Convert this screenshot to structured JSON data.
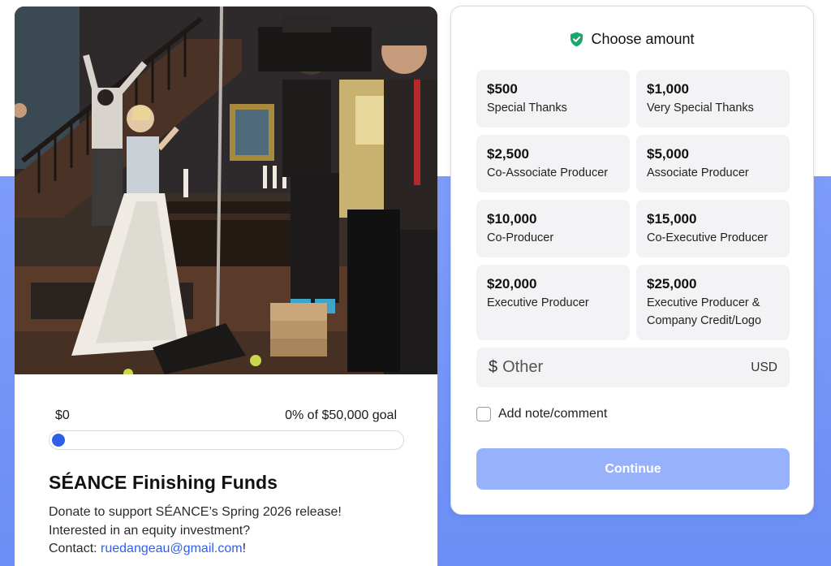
{
  "campaign": {
    "raised": "$0",
    "goal_text": "0% of $50,000 goal",
    "progress_percent": 0,
    "title": "SÉANCE Finishing Funds",
    "desc_line1": "Donate to support SÉANCE’s Spring 2026 release!",
    "desc_line2": "Interested in an equity investment?",
    "contact_prefix": "Contact: ",
    "contact_email": "ruedangeau@gmail.com",
    "contact_suffix": "!"
  },
  "donation": {
    "header": "Choose amount",
    "tiers": [
      {
        "amount": "$500",
        "label": "Special Thanks"
      },
      {
        "amount": "$1,000",
        "label": "Very Special Thanks"
      },
      {
        "amount": "$2,500",
        "label": "Co-Associate Producer"
      },
      {
        "amount": "$5,000",
        "label": "Associate Producer"
      },
      {
        "amount": "$10,000",
        "label": "Co-Producer"
      },
      {
        "amount": "$15,000",
        "label": "Co-Executive Producer"
      },
      {
        "amount": "$20,000",
        "label": "Executive Producer"
      },
      {
        "amount": "$25,000",
        "label": "Executive Producer & Company Credit/Logo"
      }
    ],
    "other_symbol": "$",
    "other_placeholder": "Other",
    "currency": "USD",
    "note_label": "Add note/comment",
    "continue_label": "Continue"
  },
  "colors": {
    "accent": "#2f5fe8",
    "background_band": "#7d9cf9",
    "button_disabled": "#97b2fb",
    "shield": "#1aa86a"
  }
}
